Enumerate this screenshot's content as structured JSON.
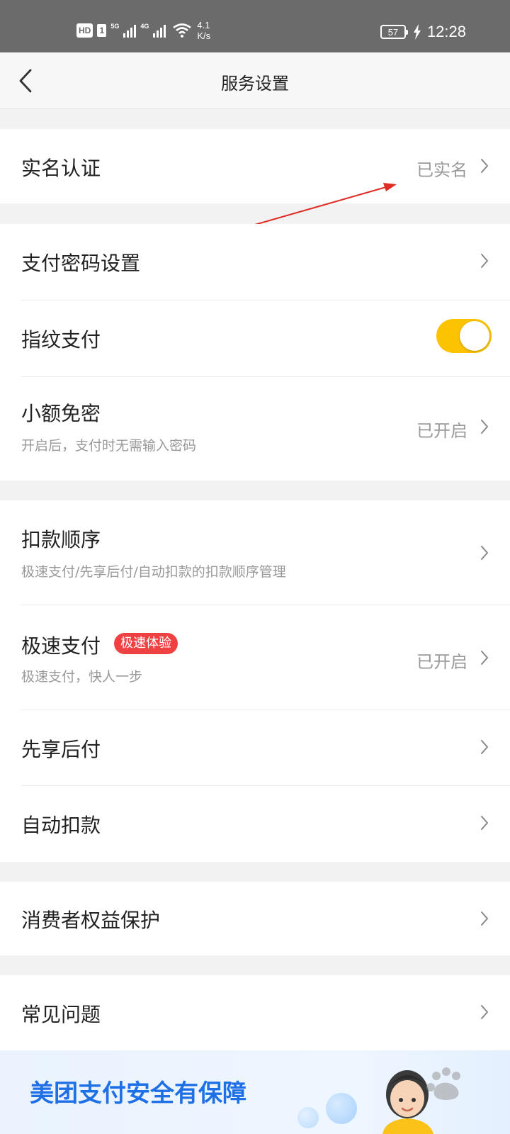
{
  "status_bar": {
    "hd_label": "HD",
    "sim_label": "1",
    "net1_label": "5G",
    "net2_label": "4G",
    "speed_value": "4.1",
    "speed_unit": "K/s",
    "battery_level": "57",
    "time": "12:28"
  },
  "header": {
    "title": "服务设置"
  },
  "rows": {
    "real_name": {
      "title": "实名认证",
      "value": "已实名"
    },
    "pay_password": {
      "title": "支付密码设置"
    },
    "fingerprint": {
      "title": "指纹支付",
      "enabled": true
    },
    "small_free": {
      "title": "小额免密",
      "subtitle": "开启后，支付时无需输入密码",
      "value": "已开启"
    },
    "deduct_order": {
      "title": "扣款顺序",
      "subtitle": "极速支付/先享后付/自动扣款的扣款顺序管理"
    },
    "fast_pay": {
      "title": "极速支付",
      "badge": "极速体验",
      "subtitle": "极速支付，快人一步",
      "value": "已开启"
    },
    "pay_later": {
      "title": "先享后付"
    },
    "auto_deduct": {
      "title": "自动扣款"
    },
    "consumer_rights": {
      "title": "消费者权益保护"
    },
    "faq": {
      "title": "常见问题"
    }
  },
  "banner": {
    "text": "美团支付安全有保障"
  },
  "colors": {
    "toggle_on": "#fcc303",
    "badge": "#f04142",
    "banner_text": "#1f6fe6"
  },
  "icons": {
    "back": "chevron-left-icon",
    "row_arrow": "chevron-right-icon"
  }
}
